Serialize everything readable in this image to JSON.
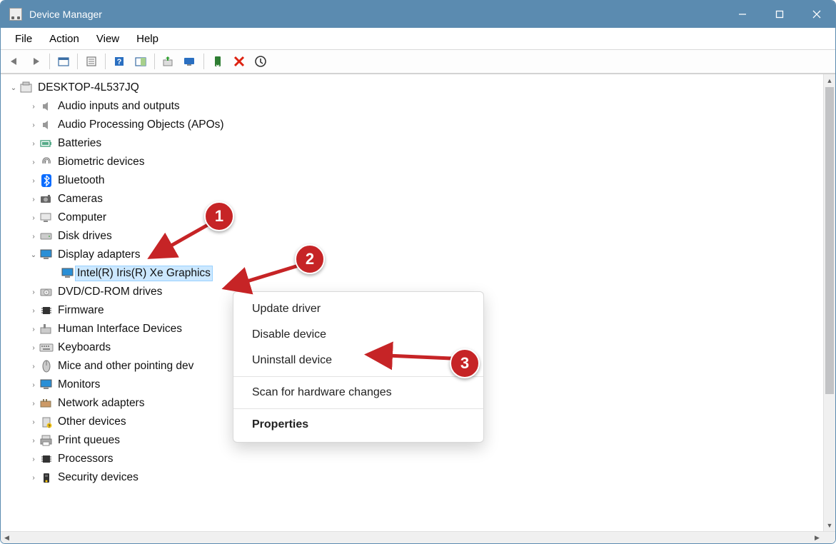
{
  "window": {
    "title": "Device Manager"
  },
  "menubar": {
    "items": [
      "File",
      "Action",
      "View",
      "Help"
    ]
  },
  "tree": {
    "root": "DESKTOP-4L537JQ",
    "items": [
      {
        "label": "Audio inputs and outputs",
        "exp": false
      },
      {
        "label": "Audio Processing Objects (APOs)",
        "exp": false
      },
      {
        "label": "Batteries",
        "exp": false
      },
      {
        "label": "Biometric devices",
        "exp": false
      },
      {
        "label": "Bluetooth",
        "exp": false
      },
      {
        "label": "Cameras",
        "exp": false
      },
      {
        "label": "Computer",
        "exp": false
      },
      {
        "label": "Disk drives",
        "exp": false
      },
      {
        "label": "Display adapters",
        "exp": true,
        "children": [
          {
            "label": "Intel(R) Iris(R) Xe Graphics",
            "selected": true
          }
        ]
      },
      {
        "label": "DVD/CD-ROM drives",
        "exp": false
      },
      {
        "label": "Firmware",
        "exp": false
      },
      {
        "label": "Human Interface Devices",
        "exp": false
      },
      {
        "label": "Keyboards",
        "exp": false
      },
      {
        "label": "Mice and other pointing dev",
        "exp": false
      },
      {
        "label": "Monitors",
        "exp": false
      },
      {
        "label": "Network adapters",
        "exp": false
      },
      {
        "label": "Other devices",
        "exp": false
      },
      {
        "label": "Print queues",
        "exp": false
      },
      {
        "label": "Processors",
        "exp": false
      },
      {
        "label": "Security devices",
        "exp": false
      }
    ]
  },
  "context_menu": {
    "items": [
      "Update driver",
      "Disable device",
      "Uninstall device"
    ],
    "items2": [
      "Scan for hardware changes"
    ],
    "bold": "Properties"
  },
  "annotations": {
    "b1": "1",
    "b2": "2",
    "b3": "3"
  }
}
